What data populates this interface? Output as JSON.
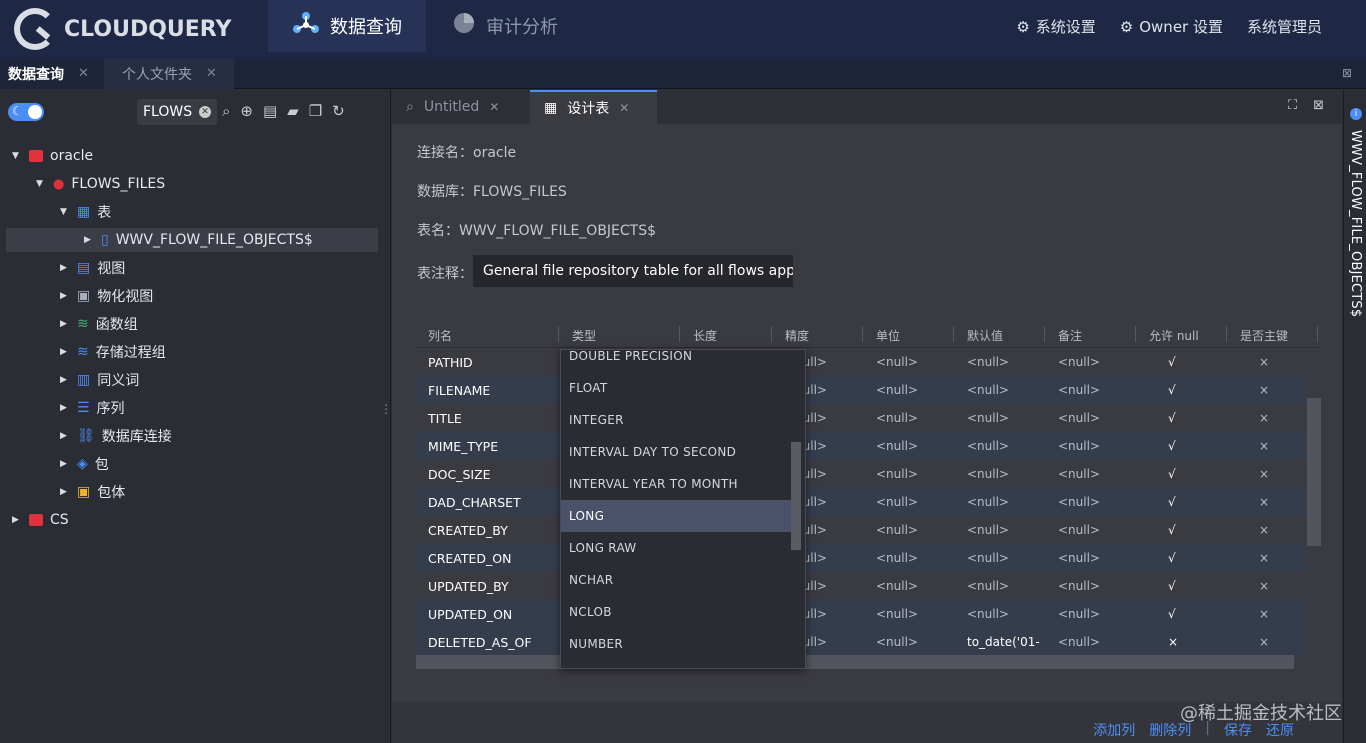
{
  "app": {
    "logo_text": "CLOUDQUERY"
  },
  "nav": {
    "tabs": [
      {
        "label": "数据查询",
        "icon": "network-icon"
      },
      {
        "label": "审计分析",
        "icon": "pie-icon"
      }
    ],
    "right": [
      {
        "label": "系统设置",
        "icon": "users-gear-icon"
      },
      {
        "label": "Owner 设置",
        "icon": "settings-icon"
      },
      {
        "label": "系统管理员",
        "icon": ""
      }
    ]
  },
  "file_tabs": [
    {
      "label": "数据查询"
    },
    {
      "label": "个人文件夹"
    }
  ],
  "sidebar": {
    "search_value": "FLOWS",
    "tree": {
      "oracle": "oracle",
      "flows_files": "FLOWS_FILES",
      "table_group": "表",
      "table_item": "WWV_FLOW_FILE_OBJECTS$",
      "view": "视图",
      "mview": "物化视图",
      "func": "函数组",
      "proc": "存储过程组",
      "synonym": "同义词",
      "sequence": "序列",
      "dblink": "数据库连接",
      "package": "包",
      "package_body": "包体",
      "cs": "CS"
    }
  },
  "editor": {
    "tabs": [
      {
        "label": "Untitled"
      },
      {
        "label": "设计表"
      }
    ],
    "conn_label": "连接名：",
    "conn_value": "oracle",
    "db_label": "数据库：",
    "db_value": "FLOWS_FILES",
    "table_label": "表名：",
    "table_value": "WWV_FLOW_FILE_OBJECTS$",
    "comment_label": "表注释：",
    "comment_value": "General file repository table for all flows appli"
  },
  "grid": {
    "headers": [
      "列名",
      "类型",
      "长度",
      "精度",
      "单位",
      "默认值",
      "备注",
      "允许 null",
      "是否主键"
    ],
    "rows": [
      {
        "name": "PATHID",
        "precision": "<null>",
        "unit": "<null>",
        "default": "<null>",
        "comment": "<null>",
        "nullable": "√",
        "pk": "×"
      },
      {
        "name": "FILENAME",
        "precision": "<null>",
        "unit": "<null>",
        "default": "<null>",
        "comment": "<null>",
        "nullable": "√",
        "pk": "×"
      },
      {
        "name": "TITLE",
        "precision": "<null>",
        "unit": "<null>",
        "default": "<null>",
        "comment": "<null>",
        "nullable": "√",
        "pk": "×"
      },
      {
        "name": "MIME_TYPE",
        "precision": "<null>",
        "unit": "<null>",
        "default": "<null>",
        "comment": "<null>",
        "nullable": "√",
        "pk": "×"
      },
      {
        "name": "DOC_SIZE",
        "precision": "<null>",
        "unit": "<null>",
        "default": "<null>",
        "comment": "<null>",
        "nullable": "√",
        "pk": "×"
      },
      {
        "name": "DAD_CHARSET",
        "precision": "<null>",
        "unit": "<null>",
        "default": "<null>",
        "comment": "<null>",
        "nullable": "√",
        "pk": "×"
      },
      {
        "name": "CREATED_BY",
        "precision": "<null>",
        "unit": "<null>",
        "default": "<null>",
        "comment": "<null>",
        "nullable": "√",
        "pk": "×"
      },
      {
        "name": "CREATED_ON",
        "precision": "<null>",
        "unit": "<null>",
        "default": "<null>",
        "comment": "<null>",
        "nullable": "√",
        "pk": "×"
      },
      {
        "name": "UPDATED_BY",
        "precision": "<null>",
        "unit": "<null>",
        "default": "<null>",
        "comment": "<null>",
        "nullable": "√",
        "pk": "×"
      },
      {
        "name": "UPDATED_ON",
        "precision": "<null>",
        "unit": "<null>",
        "default": "<null>",
        "comment": "<null>",
        "nullable": "√",
        "pk": "×"
      },
      {
        "name": "DELETED_AS_OF",
        "precision": "<null>",
        "unit": "<null>",
        "default": "to_date('01-",
        "comment": "<null>",
        "nullable": "×",
        "pk": "×"
      }
    ]
  },
  "type_dropdown": {
    "options": [
      "DOUBLE PRECISION",
      "FLOAT",
      "INTEGER",
      "INTERVAL DAY TO SECOND",
      "INTERVAL YEAR TO MONTH",
      "LONG",
      "LONG RAW",
      "NCHAR",
      "NCLOB",
      "NUMBER"
    ],
    "highlighted": "LONG"
  },
  "actions": {
    "add_col": "添加列",
    "del_col": "删除列",
    "save": "保存",
    "restore": "还原"
  },
  "right_panel": {
    "title": "WWV_FLOW_FILE_OBJECTS$"
  },
  "watermark": "@稀土掘金技术社区",
  "colors": {
    "accent": "#4b8ef5",
    "topbar": "#1e2845",
    "oracle_red": "#e0323c"
  }
}
